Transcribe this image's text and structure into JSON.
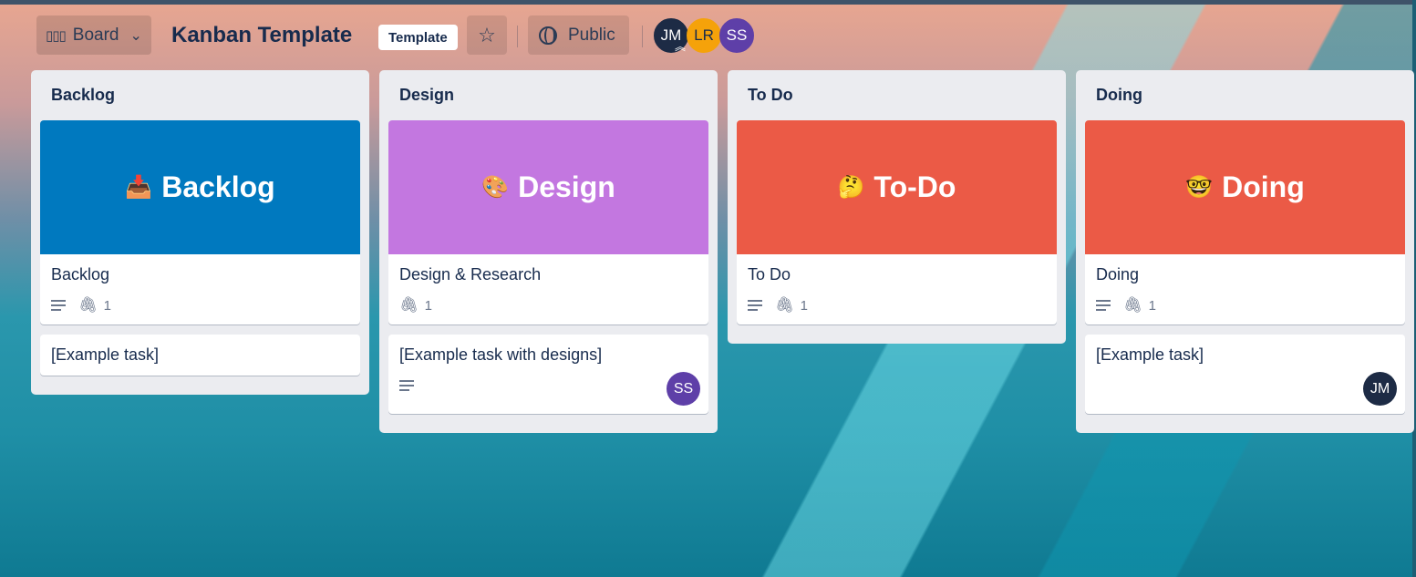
{
  "header": {
    "view_label": "Board",
    "view_icon": "board-view-icon",
    "board_title": "Kanban Template",
    "template_badge": "Template",
    "star_icon": "star-icon",
    "visibility_label": "Public",
    "visibility_icon": "globe-icon",
    "members": [
      {
        "initials": "JM",
        "color": "#1d2b45"
      },
      {
        "initials": "LR",
        "color": "#f5a20a"
      },
      {
        "initials": "SS",
        "color": "#5e3fa8"
      }
    ]
  },
  "lists": [
    {
      "title": "Backlog",
      "cards": [
        {
          "cover_text": "Backlog",
          "cover_emoji": "📥",
          "cover_color": "#0079bf",
          "title": "Backlog",
          "attachments": "1"
        },
        {
          "title": "[Example task]"
        }
      ]
    },
    {
      "title": "Design",
      "cards": [
        {
          "cover_text": "Design",
          "cover_emoji": "🎨",
          "cover_color": "#c377e0",
          "title": "Design & Research",
          "attachments": "1"
        },
        {
          "title": "[Example task with designs]",
          "member": "SS"
        }
      ]
    },
    {
      "title": "To Do",
      "cards": [
        {
          "cover_text": "To-Do",
          "cover_emoji": "🤔",
          "cover_color": "#eb5a46",
          "title": "To Do",
          "attachments": "1"
        }
      ]
    },
    {
      "title": "Doing",
      "cards": [
        {
          "cover_text": "Doing",
          "cover_emoji": "🤓",
          "cover_color": "#eb5a46",
          "title": "Doing",
          "attachments": "1"
        },
        {
          "title": "[Example task]",
          "member": "JM"
        }
      ]
    }
  ]
}
